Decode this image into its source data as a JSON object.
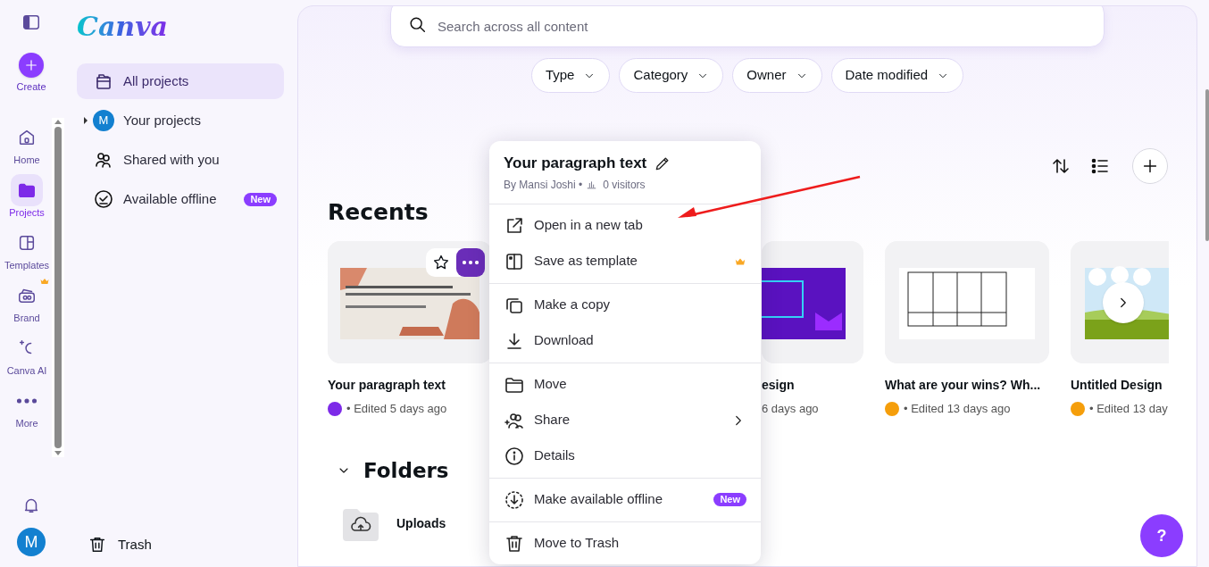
{
  "rail": {
    "create": "Create",
    "avatar": "M",
    "items": [
      {
        "kind": "home",
        "label": "Home",
        "selected": false
      },
      {
        "kind": "projects",
        "label": "Projects",
        "selected": true
      },
      {
        "kind": "templates",
        "label": "Templates",
        "selected": false
      },
      {
        "kind": "brand",
        "label": "Brand",
        "selected": false,
        "premium": true
      },
      {
        "kind": "ai",
        "label": "Canva AI",
        "selected": false
      },
      {
        "kind": "more",
        "label": "More",
        "selected": false
      }
    ]
  },
  "sidebar": {
    "logo": "Canva",
    "trash": "Trash",
    "items": [
      {
        "kind": "folders",
        "label": "All projects",
        "selected": true
      },
      {
        "kind": "avatar",
        "label": "Your projects",
        "selected": false,
        "avatar": "M",
        "expanded": false
      },
      {
        "kind": "shared",
        "label": "Shared with you",
        "selected": false
      },
      {
        "kind": "offline",
        "label": "Available offline",
        "selected": false,
        "badge": "New"
      }
    ]
  },
  "search": {
    "placeholder": "Search across all content"
  },
  "filters": [
    "Type",
    "Category",
    "Owner",
    "Date modified"
  ],
  "recents": {
    "title": "Recents",
    "designs": [
      {
        "title": "Your paragraph text",
        "meta": "• Edited 5 days ago",
        "color": "#7d2ae8",
        "hovered": true,
        "covered": false
      },
      {
        "title": "esign",
        "meta": "6 days ago",
        "covered": true
      },
      {
        "title": "What are your wins? Wh...",
        "meta": "• Edited 13 days ago",
        "color": "#f59e0b",
        "hovered": false,
        "covered": false
      },
      {
        "title": "Untitled Design",
        "meta": "• Edited 13 day",
        "color": "#f59e0b",
        "covered": false
      }
    ]
  },
  "folders": {
    "title": "Folders",
    "expanded": true,
    "items": [
      "Uploads"
    ]
  },
  "menu": {
    "title": "Your paragraph text",
    "owner": "By Mansi Joshi •",
    "visitors": "0 visitors",
    "groups": [
      [
        {
          "kind": "external",
          "label": "Open in a new tab"
        },
        {
          "kind": "template",
          "label": "Save as template",
          "premium": true
        }
      ],
      [
        {
          "kind": "copy",
          "label": "Make a copy"
        },
        {
          "kind": "download",
          "label": "Download"
        }
      ],
      [
        {
          "kind": "move",
          "label": "Move"
        },
        {
          "kind": "share",
          "label": "Share",
          "submenu": true
        },
        {
          "kind": "info",
          "label": "Details"
        }
      ],
      [
        {
          "kind": "offline",
          "label": "Make available offline",
          "badge": "New"
        }
      ],
      [
        {
          "kind": "trash",
          "label": "Move to Trash"
        }
      ]
    ]
  },
  "help": "?"
}
